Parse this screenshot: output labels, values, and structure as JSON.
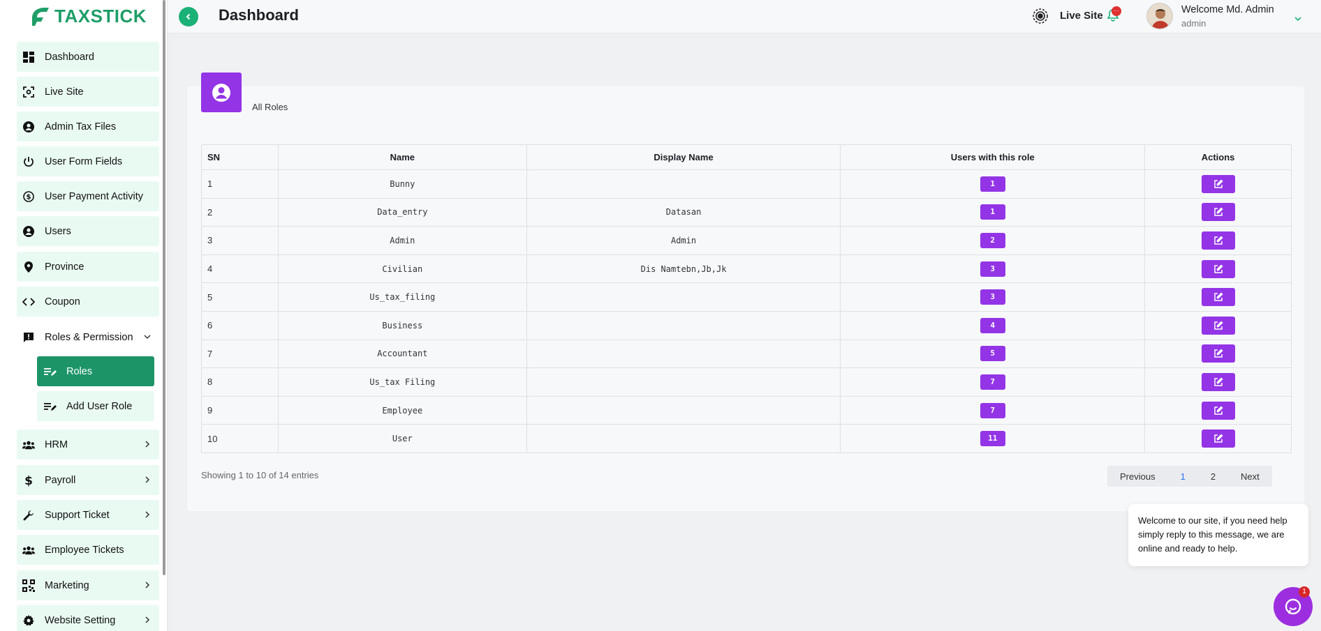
{
  "brand": {
    "name": "TAXSTICK",
    "color": "#1f9e68"
  },
  "sidebar": {
    "items": [
      {
        "label": "Dashboard",
        "icon": "dashboard-icon"
      },
      {
        "label": "Live Site",
        "icon": "scan-icon"
      },
      {
        "label": "Admin Tax Files",
        "icon": "user-circle-icon"
      },
      {
        "label": "User Form Fields",
        "icon": "power-icon"
      },
      {
        "label": "User Payment Activity",
        "icon": "dollar-circle-icon"
      },
      {
        "label": "Users",
        "icon": "user-circle-icon"
      },
      {
        "label": "Province",
        "icon": "map-pin-icon"
      },
      {
        "label": "Coupon",
        "icon": "code-icon"
      },
      {
        "label": "Roles & Permission",
        "icon": "alert-message-icon"
      },
      {
        "label": "Roles",
        "icon": "list-edit-icon"
      },
      {
        "label": "Add User Role",
        "icon": "list-edit-icon"
      },
      {
        "label": "HRM",
        "icon": "users-icon"
      },
      {
        "label": "Payroll",
        "icon": "dollar-icon"
      },
      {
        "label": "Support Ticket",
        "icon": "wrench-icon"
      },
      {
        "label": "Employee Tickets",
        "icon": "users-icon"
      },
      {
        "label": "Marketing",
        "icon": "qr-code-icon"
      },
      {
        "label": "Website Setting",
        "icon": "gear-icon"
      }
    ]
  },
  "header": {
    "title": "Dashboard",
    "live_site": "Live Site",
    "notification_badge": "···",
    "welcome": "Welcome Md. Admin",
    "role": "admin"
  },
  "card": {
    "title": "All Roles"
  },
  "table": {
    "headers": [
      "SN",
      "Name",
      "Display Name",
      "Users with this role",
      "Actions"
    ],
    "rows": [
      {
        "sn": "1",
        "name": "Bunny",
        "display": "",
        "users": "1"
      },
      {
        "sn": "2",
        "name": "Data_entry",
        "display": "Datasan",
        "users": "1"
      },
      {
        "sn": "3",
        "name": "Admin",
        "display": "Admin",
        "users": "2"
      },
      {
        "sn": "4",
        "name": "Civilian",
        "display": "Dis Namtebn,Jb,Jk",
        "users": "3"
      },
      {
        "sn": "5",
        "name": "Us_tax_filing",
        "display": "",
        "users": "3"
      },
      {
        "sn": "6",
        "name": "Business",
        "display": "",
        "users": "4"
      },
      {
        "sn": "7",
        "name": "Accountant",
        "display": "",
        "users": "5"
      },
      {
        "sn": "8",
        "name": "Us_tax Filing",
        "display": "",
        "users": "7"
      },
      {
        "sn": "9",
        "name": "Employee",
        "display": "",
        "users": "7"
      },
      {
        "sn": "10",
        "name": "User",
        "display": "",
        "users": "11"
      }
    ]
  },
  "pagination": {
    "showing": "Showing 1 to 10 of 14 entries",
    "previous": "Previous",
    "pages": [
      "1",
      "2"
    ],
    "next": "Next"
  },
  "chat": {
    "message": "Welcome to our site, if you need help simply reply to this message, we are online and ready to help.",
    "badge": "1"
  },
  "colors": {
    "accent_purple": "#9334e6",
    "accent_green": "#1c9468"
  }
}
